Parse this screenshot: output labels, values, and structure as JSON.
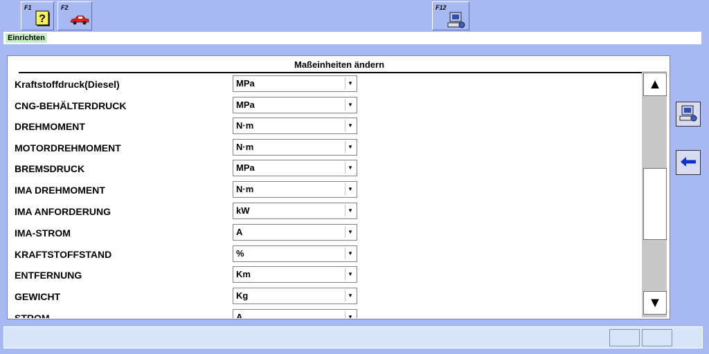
{
  "toolbar": {
    "f1": {
      "label": "F1",
      "icon": "help-question-icon"
    },
    "f2": {
      "label": "F2",
      "icon": "car-icon"
    },
    "f12": {
      "label": "F12",
      "icon": "computer-settings-icon"
    }
  },
  "header": {
    "mode": "Einrichten"
  },
  "panel": {
    "title": "Maßeinheiten ändern",
    "rows": [
      {
        "name": "Kraftstoffdruck(Diesel)",
        "unit": "MPa"
      },
      {
        "name": "CNG-BEHÄLTERDRUCK",
        "unit": "MPa"
      },
      {
        "name": "DREHMOMENT",
        "unit": "N·m"
      },
      {
        "name": "MOTORDREHMOMENT",
        "unit": "N·m"
      },
      {
        "name": "BREMSDRUCK",
        "unit": "MPa"
      },
      {
        "name": "IMA DREHMOMENT",
        "unit": "N·m"
      },
      {
        "name": "IMA ANFORDERUNG",
        "unit": "kW"
      },
      {
        "name": "IMA-STROM",
        "unit": "A"
      },
      {
        "name": "KRAFTSTOFFSTAND",
        "unit": "%"
      },
      {
        "name": "ENTFERNUNG",
        "unit": "Km"
      },
      {
        "name": "GEWICHT",
        "unit": "Kg"
      },
      {
        "name": "STROM",
        "unit": "A"
      }
    ]
  },
  "scrollbar": {
    "up_icon": "triangle-up-icon",
    "down_icon": "triangle-down-icon"
  },
  "side": {
    "print_icon": "computer-settings-icon",
    "back_icon": "arrow-left-icon"
  },
  "colors": {
    "background": "#a8b8f0",
    "mode_tag": "#c8f0c8",
    "back_arrow": "#1030d0"
  }
}
